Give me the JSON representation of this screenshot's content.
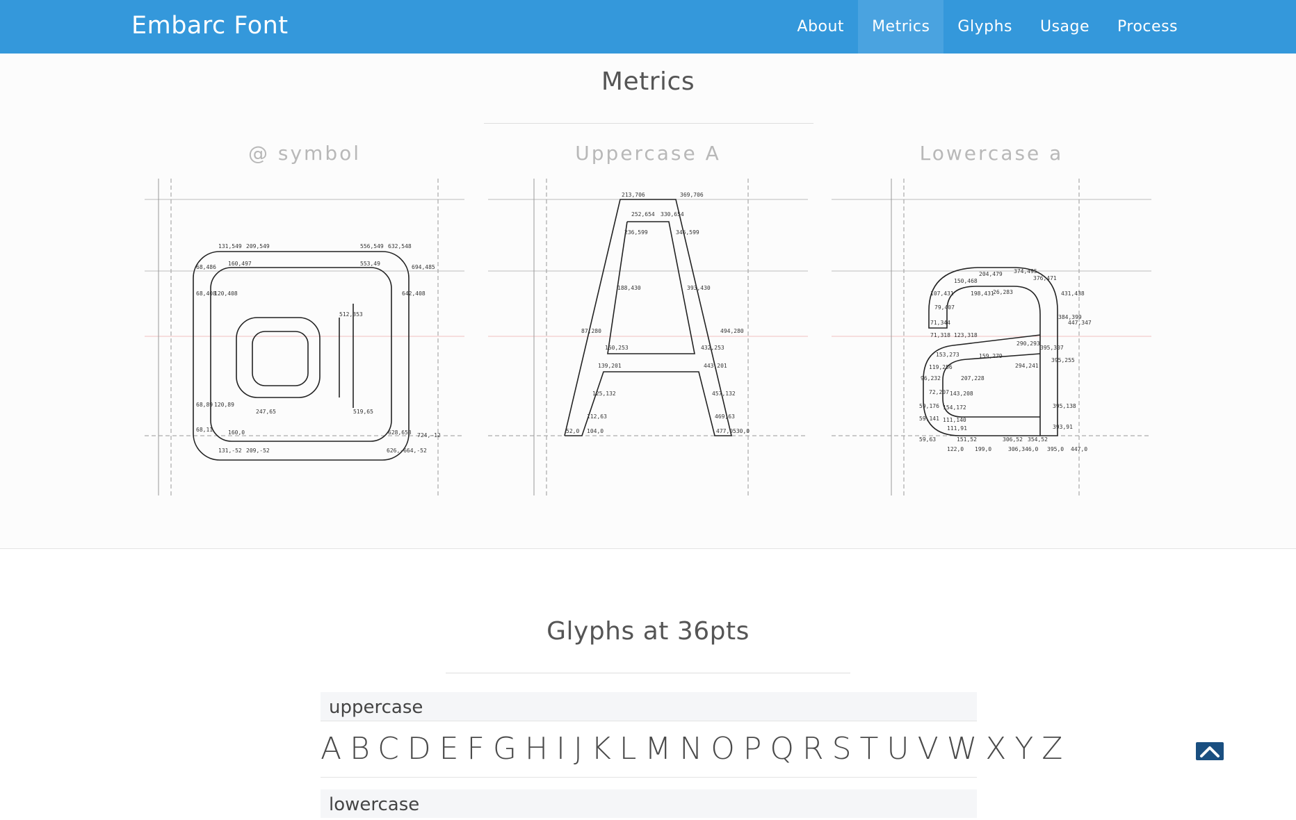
{
  "navbar": {
    "brand": "Embarc Font",
    "items": [
      {
        "label": "About",
        "active": false
      },
      {
        "label": "Metrics",
        "active": true
      },
      {
        "label": "Glyphs",
        "active": false
      },
      {
        "label": "Usage",
        "active": false
      },
      {
        "label": "Process",
        "active": false
      }
    ]
  },
  "metrics": {
    "title": "Metrics",
    "panels": [
      {
        "label": "@ symbol"
      },
      {
        "label": "Uppercase A"
      },
      {
        "label": "Lowercase a"
      }
    ]
  },
  "glyphs": {
    "title": "Glyphs at 36pts",
    "uppercase_label": "uppercase",
    "uppercase_chars": "ABCDEFGHIJKLMNOPQRSTUVWXYZ",
    "lowercase_label": "lowercase"
  },
  "colors": {
    "navbar": "#3498db",
    "active_nav": "#4aa3e0",
    "back_to_top": "#1a4f80"
  },
  "icons": {
    "back_to_top": "chevron-up-icon"
  }
}
